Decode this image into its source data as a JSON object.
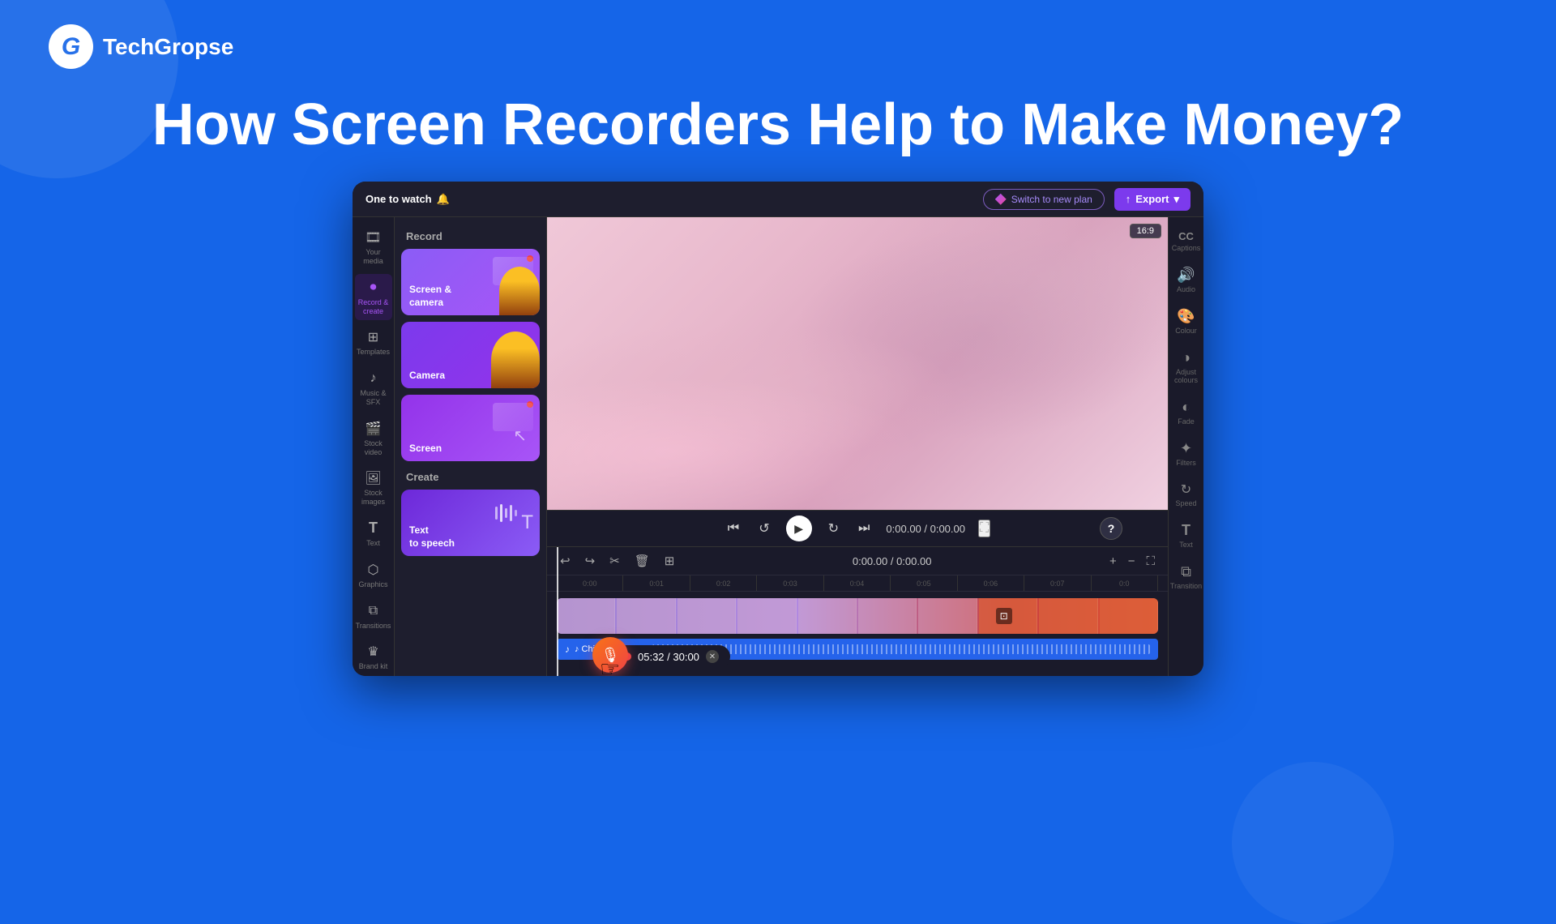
{
  "page": {
    "background_color": "#1565e8",
    "title": "How Screen Recorders Help to Make Money?"
  },
  "logo": {
    "text": "TechGropse",
    "icon": "G"
  },
  "app": {
    "top_bar": {
      "tab_label": "One to watch",
      "switch_plan_label": "Switch to new plan",
      "export_label": "Export"
    },
    "aspect_ratio": "16:9",
    "time_current": "0:00.00",
    "time_total": "0:00.00",
    "full_time_display": "0:00.00 / 0:00.00"
  },
  "sidebar": {
    "items": [
      {
        "id": "your-media",
        "label": "Your media",
        "icon": "🎞"
      },
      {
        "id": "record-create",
        "label": "Record & create",
        "icon": "⏺",
        "active": true
      },
      {
        "id": "templates",
        "label": "Templates",
        "icon": "⊞"
      },
      {
        "id": "music-sfx",
        "label": "Music & SFX",
        "icon": "♪"
      },
      {
        "id": "stock-video",
        "label": "Stock video",
        "icon": "🎬"
      },
      {
        "id": "stock-images",
        "label": "Stock images",
        "icon": "🖼"
      },
      {
        "id": "text",
        "label": "Text",
        "icon": "T"
      },
      {
        "id": "graphics",
        "label": "Graphics",
        "icon": "⬡"
      },
      {
        "id": "transitions",
        "label": "Transitions",
        "icon": "⧉"
      },
      {
        "id": "brand-kit",
        "label": "Brand kit",
        "icon": "♛"
      }
    ]
  },
  "record_panel": {
    "record_section_title": "Record",
    "create_section_title": "Create",
    "cards": [
      {
        "id": "screen-camera",
        "label": "Screen &\ncamera",
        "type": "screen-camera"
      },
      {
        "id": "camera",
        "label": "Camera",
        "type": "camera"
      },
      {
        "id": "screen",
        "label": "Screen",
        "type": "screen"
      }
    ],
    "create_cards": [
      {
        "id": "text-to-speech",
        "label": "Text\nto speech",
        "type": "tts"
      }
    ]
  },
  "right_panel": {
    "items": [
      {
        "id": "captions",
        "label": "Captions",
        "icon": "CC"
      },
      {
        "id": "audio",
        "label": "Audio",
        "icon": "🔊"
      },
      {
        "id": "colour",
        "label": "Colour",
        "icon": "🎨"
      },
      {
        "id": "adjust-colours",
        "label": "Adjust colours",
        "icon": "◑"
      },
      {
        "id": "fade",
        "label": "Fade",
        "icon": "◐"
      },
      {
        "id": "filters",
        "label": "Filters",
        "icon": "✦"
      },
      {
        "id": "speed",
        "label": "Speed",
        "icon": "⟳"
      },
      {
        "id": "text",
        "label": "Text",
        "icon": "T"
      },
      {
        "id": "transition",
        "label": "Transition",
        "icon": "⧉"
      }
    ]
  },
  "timeline": {
    "toolbar": {
      "undo": "↩",
      "redo": "↪",
      "scissors": "✂",
      "trash": "🗑",
      "more": "⊞"
    },
    "time_label": "0:00.00 / 0:00.00",
    "ruler_marks": [
      "0:00",
      "0:01",
      "0:02",
      "0:03",
      "0:04",
      "0:05",
      "0:06",
      "0:07",
      "0:0"
    ],
    "audio_track_label": "♪ Chill sound track"
  },
  "recording": {
    "timer": "05:32 / 30:00"
  },
  "help_button_label": "?"
}
